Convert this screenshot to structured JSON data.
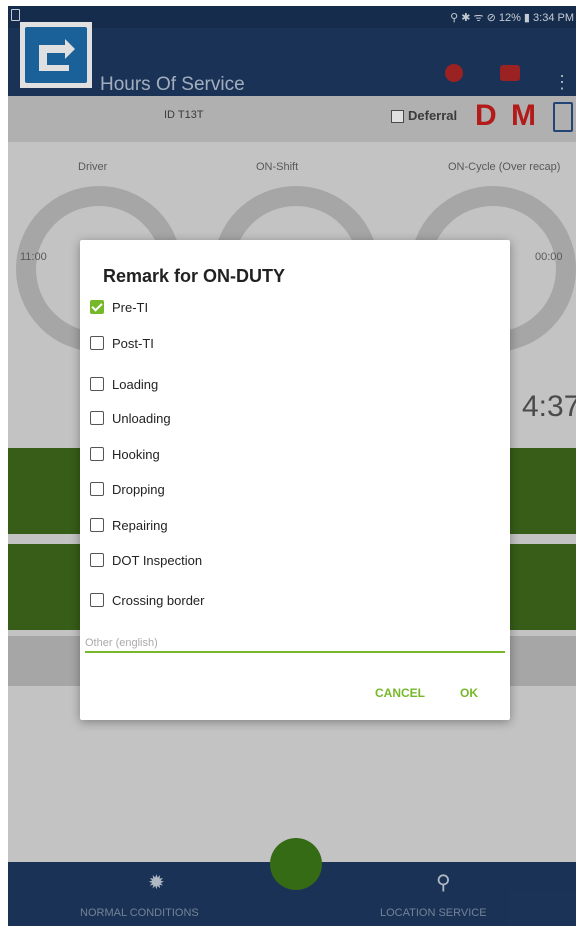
{
  "status_bar": {
    "right_text": "⚲ ✱ ᯤ ⊘ 12% ▮ 3:34 PM"
  },
  "app_bar": {
    "title": "Hours Of Service",
    "menu_glyph": "⋮"
  },
  "sub_bar": {
    "vehicle_id": "ID T13T",
    "deferral_label": "Deferral",
    "letter_d": "D",
    "letter_m": "M"
  },
  "summary": {
    "col_driver": "Driver",
    "col_shift": "ON-Shift",
    "col_cycle": "ON-Cycle (Over recap)",
    "left_time": "11:00",
    "right_time": "00:00",
    "big_time": "4:37"
  },
  "dialog": {
    "title": "Remark for ON-DUTY",
    "options": [
      {
        "label": "Pre-TI",
        "checked": true
      },
      {
        "label": "Post-TI",
        "checked": false
      },
      {
        "label": "Loading",
        "checked": false
      },
      {
        "label": "Unloading",
        "checked": false
      },
      {
        "label": "Hooking",
        "checked": false
      },
      {
        "label": "Dropping",
        "checked": false
      },
      {
        "label": "Repairing",
        "checked": false
      },
      {
        "label": "DOT Inspection",
        "checked": false
      },
      {
        "label": "Crossing border",
        "checked": false
      }
    ],
    "other_placeholder": "Other (english)",
    "cancel_label": "CANCEL",
    "ok_label": "OK"
  },
  "bottom_bar": {
    "left_label": "NORMAL CONDITIONS",
    "right_label": "LOCATION SERVICE"
  },
  "colors": {
    "accent_green": "#76b82a",
    "navy": "#1f3a63",
    "alert_red": "#cc1f1f"
  },
  "icons": [
    "app-logo-icon",
    "alert-icon",
    "message-icon",
    "overflow-menu-icon",
    "clipboard-icon",
    "sun-icon",
    "location-pin-icon"
  ]
}
